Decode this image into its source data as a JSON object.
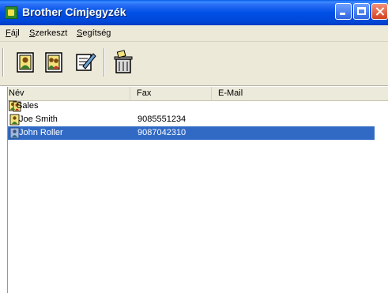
{
  "window": {
    "title": "Brother Címjegyzék"
  },
  "menu": [
    {
      "label": "Fájl",
      "accel": "F"
    },
    {
      "label": "Szerkeszt",
      "accel": "S"
    },
    {
      "label": "Segítség",
      "accel": "S"
    }
  ],
  "toolbar": [
    {
      "name": "new-contact-icon"
    },
    {
      "name": "new-group-icon"
    },
    {
      "name": "edit-icon"
    },
    {
      "name": "delete-icon"
    }
  ],
  "list": {
    "columns": [
      "Név",
      "Fax",
      "E-Mail"
    ],
    "rows": [
      {
        "type": "group",
        "name": "Sales",
        "fax": "",
        "email": ""
      },
      {
        "type": "contact",
        "name": "Joe Smith",
        "fax": "9085551234",
        "email": ""
      },
      {
        "type": "contact",
        "name": "John Roller",
        "fax": "9087042310",
        "email": "",
        "selected": true
      }
    ]
  },
  "colors": {
    "titlebar": "#0050e6",
    "selection": "#316ac5",
    "chrome": "#ece9d8"
  }
}
